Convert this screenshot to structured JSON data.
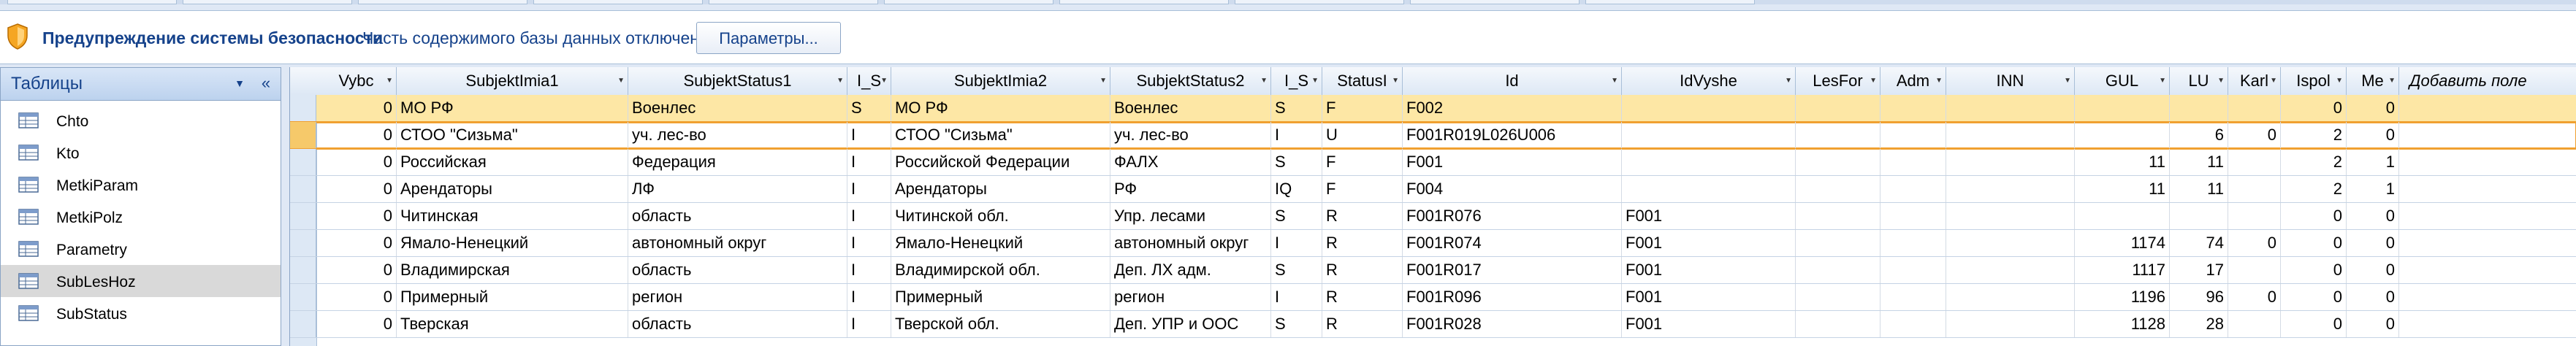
{
  "security_bar": {
    "title": "Предупреждение системы безопасности",
    "message": "Часть содержимого базы данных отключено",
    "options_button": "Параметры..."
  },
  "nav_pane": {
    "title": "Таблицы",
    "items": [
      {
        "label": "Chto",
        "selected": false
      },
      {
        "label": "Kto",
        "selected": false
      },
      {
        "label": "MetkiParam",
        "selected": false
      },
      {
        "label": "MetkiPolz",
        "selected": false
      },
      {
        "label": "Parametry",
        "selected": false
      },
      {
        "label": "SubLesHoz",
        "selected": true
      },
      {
        "label": "SubStatus",
        "selected": false
      }
    ]
  },
  "table": {
    "columns": [
      {
        "label": "Vybc",
        "align": "num"
      },
      {
        "label": "SubjektImia1",
        "align": "text"
      },
      {
        "label": "SubjektStatus1",
        "align": "text"
      },
      {
        "label": "I_S",
        "align": "text"
      },
      {
        "label": "SubjektImia2",
        "align": "text"
      },
      {
        "label": "SubjektStatus2",
        "align": "text"
      },
      {
        "label": "I_S",
        "align": "text"
      },
      {
        "label": "StatusI",
        "align": "text"
      },
      {
        "label": "Id",
        "align": "text"
      },
      {
        "label": "IdVyshe",
        "align": "text"
      },
      {
        "label": "LesFor",
        "align": "text"
      },
      {
        "label": "Adm",
        "align": "text"
      },
      {
        "label": "INN",
        "align": "text"
      },
      {
        "label": "GUL",
        "align": "num"
      },
      {
        "label": "LU",
        "align": "num"
      },
      {
        "label": "Karl",
        "align": "num"
      },
      {
        "label": "Ispol",
        "align": "num"
      },
      {
        "label": "Me",
        "align": "num"
      }
    ],
    "add_field_label": "Добавить поле",
    "rows": [
      {
        "cells": [
          "0",
          "МО РФ",
          "Военлес",
          "S",
          "МО РФ",
          "Военлес",
          "S",
          "F",
          "F002",
          "",
          "",
          "",
          "",
          "",
          "",
          "",
          "0",
          "0"
        ],
        "state": "selected"
      },
      {
        "cells": [
          "0",
          "СТОО \"Сизьма\"",
          "уч. лес-во",
          "I",
          "СТОО \"Сизьма\"",
          "уч. лес-во",
          "I",
          "U",
          "F001R019L026U006",
          "",
          "",
          "",
          "",
          "",
          "6",
          "0",
          "2",
          "0"
        ],
        "state": "current"
      },
      {
        "cells": [
          "0",
          "Российская",
          "Федерация",
          "I",
          "Российской Федерации",
          "ФАЛХ",
          "S",
          "F",
          "F001",
          "",
          "",
          "",
          "",
          "11",
          "11",
          "",
          "2",
          "1"
        ],
        "state": ""
      },
      {
        "cells": [
          "0",
          "Арендаторы",
          "ЛФ",
          "I",
          "Арендаторы",
          "РФ",
          "IQ",
          "F",
          "F004",
          "",
          "",
          "",
          "",
          "11",
          "11",
          "",
          "2",
          "1"
        ],
        "state": ""
      },
      {
        "cells": [
          "0",
          "Читинская",
          "область",
          "I",
          "Читинской обл.",
          "Упр. лесами",
          "S",
          "R",
          "F001R076",
          "F001",
          "",
          "",
          "",
          "",
          "",
          "",
          "0",
          "0"
        ],
        "state": ""
      },
      {
        "cells": [
          "0",
          "Ямало-Ненецкий",
          "автономный округ",
          "I",
          "Ямало-Ненецкий",
          "автономный округ",
          "I",
          "R",
          "F001R074",
          "F001",
          "",
          "",
          "",
          "1174",
          "74",
          "0",
          "0",
          "0"
        ],
        "state": ""
      },
      {
        "cells": [
          "0",
          "Владимирская",
          "область",
          "I",
          "Владимирской обл.",
          "Деп. ЛХ адм.",
          "S",
          "R",
          "F001R017",
          "F001",
          "",
          "",
          "",
          "1117",
          "17",
          "",
          "0",
          "0"
        ],
        "state": ""
      },
      {
        "cells": [
          "0",
          "Примерный",
          "регион",
          "I",
          "Примерный",
          "регион",
          "I",
          "R",
          "F001R096",
          "F001",
          "",
          "",
          "",
          "1196",
          "96",
          "0",
          "0",
          "0"
        ],
        "state": ""
      },
      {
        "cells": [
          "0",
          "Тверская",
          "область",
          "I",
          "Тверской обл.",
          "Деп. УПР и ООС",
          "S",
          "R",
          "F001R028",
          "F001",
          "",
          "",
          "",
          "1128",
          "28",
          "",
          "0",
          "0"
        ],
        "state": ""
      }
    ]
  },
  "colors": {
    "accent": "#15428b",
    "selected_row": "#fde7a5",
    "current_outline": "#f0a030"
  }
}
